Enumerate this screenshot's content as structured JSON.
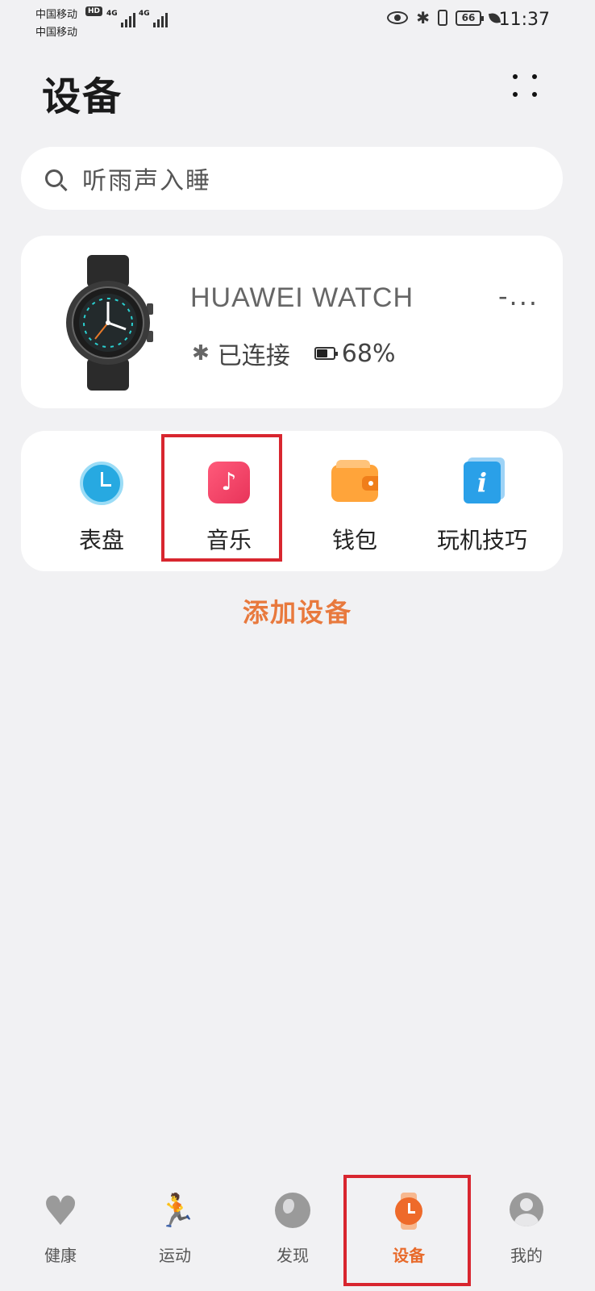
{
  "status_bar": {
    "carrier_1": "中国移动",
    "carrier_2": "中国移动",
    "hd": "HD",
    "network_1": "4G",
    "network_2": "4G",
    "battery_level": "66",
    "time": "11:37",
    "icons": [
      "eye-icon",
      "bluetooth-icon",
      "vibrate-icon",
      "battery-icon",
      "leaf-icon"
    ]
  },
  "header": {
    "title": "设备",
    "more_icon": "more-dots-icon"
  },
  "search": {
    "placeholder": "听雨声入睡",
    "icon": "search-icon"
  },
  "device": {
    "name": "HUAWEI WATCH",
    "more": "-...",
    "status": "已连接",
    "battery": "68%",
    "battery_fraction": 0.68,
    "icons": [
      "watch-image",
      "bluetooth-icon",
      "battery-icon"
    ]
  },
  "shortcuts": [
    {
      "label": "表盘",
      "icon": "watch-dial-icon"
    },
    {
      "label": "音乐",
      "icon": "music-icon"
    },
    {
      "label": "钱包",
      "icon": "wallet-icon"
    },
    {
      "label": "玩机技巧",
      "icon": "tips-icon"
    }
  ],
  "add_device": "添加设备",
  "bottom_nav": [
    {
      "label": "健康",
      "icon": "heart-icon",
      "active": false
    },
    {
      "label": "运动",
      "icon": "running-icon",
      "active": false
    },
    {
      "label": "发现",
      "icon": "globe-icon",
      "active": false
    },
    {
      "label": "设备",
      "icon": "watch-icon",
      "active": true
    },
    {
      "label": "我的",
      "icon": "avatar-icon",
      "active": false
    }
  ],
  "colors": {
    "accent": "#e8793d",
    "highlight": "#d8262f",
    "background": "#f1f1f3"
  }
}
